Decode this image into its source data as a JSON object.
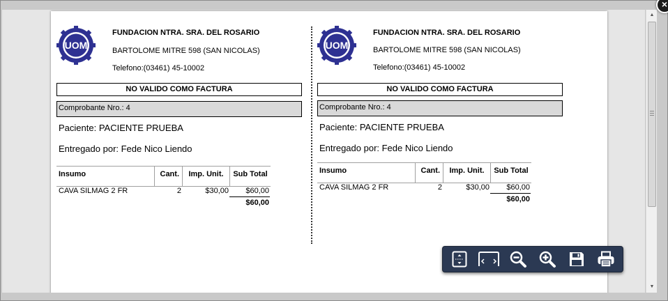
{
  "window": {
    "close_label": "×"
  },
  "receipts": [
    {
      "org_name": "FUNDACION NTRA. SRA. DEL ROSARIO",
      "address": "BARTOLOME MITRE 598 (SAN NICOLAS)",
      "phone": "Telefono:(03461) 45-10002",
      "not_valid": "NO VALIDO COMO FACTURA",
      "voucher": "Comprobante Nro.: 4",
      "patient": "Paciente: PACIENTE PRUEBA",
      "delivered_by": "Entregado por: Fede Nico Liendo",
      "columns": [
        "Insumo",
        "Cant.",
        "Imp. Unit.",
        "Sub Total"
      ],
      "rows": [
        {
          "item": "CAVA SILMAG 2 FR",
          "qty": "2",
          "unit": "$30,00",
          "subtotal": "$60,00"
        }
      ],
      "total": "$60,00"
    },
    {
      "org_name": "FUNDACION NTRA. SRA. DEL ROSARIO",
      "address": "BARTOLOME MITRE 598 (SAN NICOLAS)",
      "phone": "Telefono:(03461) 45-10002",
      "not_valid": "NO VALIDO COMO FACTURA",
      "voucher": "Comprobante Nro.: 4",
      "patient": "Paciente: PACIENTE PRUEBA",
      "delivered_by": "Entregado por: Fede Nico Liendo",
      "columns": [
        "Insumo",
        "Cant.",
        "Imp. Unit.",
        "Sub Total"
      ],
      "rows": [
        {
          "item": "CAVA SILMAG 2 FR",
          "qty": "2",
          "unit": "$30,00",
          "subtotal": "$60,00"
        }
      ],
      "total": "$60,00"
    }
  ],
  "logo": {
    "text": "UOM",
    "color": "#2e3192"
  },
  "toolbar": {
    "buttons": [
      "fit-page-icon",
      "fit-width-icon",
      "zoom-out-icon",
      "zoom-in-icon",
      "save-icon",
      "print-icon"
    ],
    "background": "#2b3953"
  },
  "scrollbar": {
    "up_arrow": "▲",
    "down_arrow": "▼"
  }
}
